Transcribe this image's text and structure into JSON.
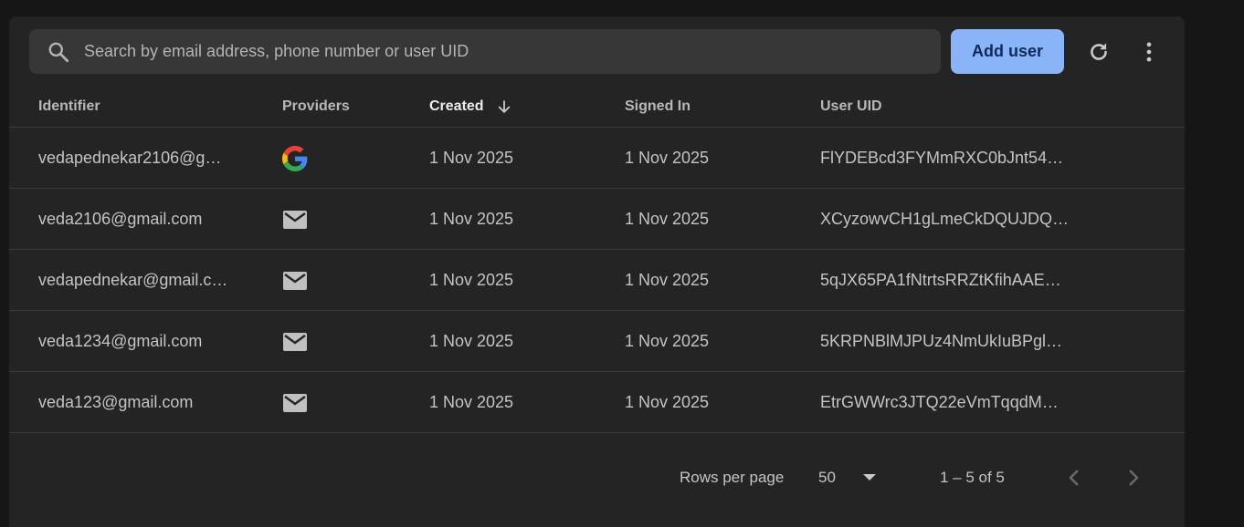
{
  "toolbar": {
    "search_placeholder": "Search by email address, phone number or user UID",
    "add_user_label": "Add user"
  },
  "table": {
    "columns": {
      "identifier": "Identifier",
      "providers": "Providers",
      "created": "Created",
      "signed_in": "Signed In",
      "user_uid": "User UID"
    },
    "rows": [
      {
        "identifier": "vedapednekar2106@g…",
        "provider": "google-icon",
        "created": "1 Nov 2025",
        "signed_in": "1 Nov 2025",
        "uid": "FlYDEBcd3FYMmRXC0bJnt54…"
      },
      {
        "identifier": "veda2106@gmail.com",
        "provider": "email-icon",
        "created": "1 Nov 2025",
        "signed_in": "1 Nov 2025",
        "uid": "XCyzowvCH1gLmeCkDQUJDQ…"
      },
      {
        "identifier": "vedapednekar@gmail.c…",
        "provider": "email-icon",
        "created": "1 Nov 2025",
        "signed_in": "1 Nov 2025",
        "uid": "5qJX65PA1fNtrtsRRZtKfihAAE…"
      },
      {
        "identifier": "veda1234@gmail.com",
        "provider": "email-icon",
        "created": "1 Nov 2025",
        "signed_in": "1 Nov 2025",
        "uid": "5KRPNBlMJPUz4NmUkIuBPgl…"
      },
      {
        "identifier": "veda123@gmail.com",
        "provider": "email-icon",
        "created": "1 Nov 2025",
        "signed_in": "1 Nov 2025",
        "uid": "EtrGWWrc3JTQ22eVmTqqdM…"
      }
    ]
  },
  "pagination": {
    "rows_per_page_label": "Rows per page",
    "rows_per_page_value": "50",
    "range_text": "1 – 5 of 5"
  },
  "colors": {
    "accent": "#8ab4f8",
    "surface": "#242424",
    "background": "#161616"
  }
}
